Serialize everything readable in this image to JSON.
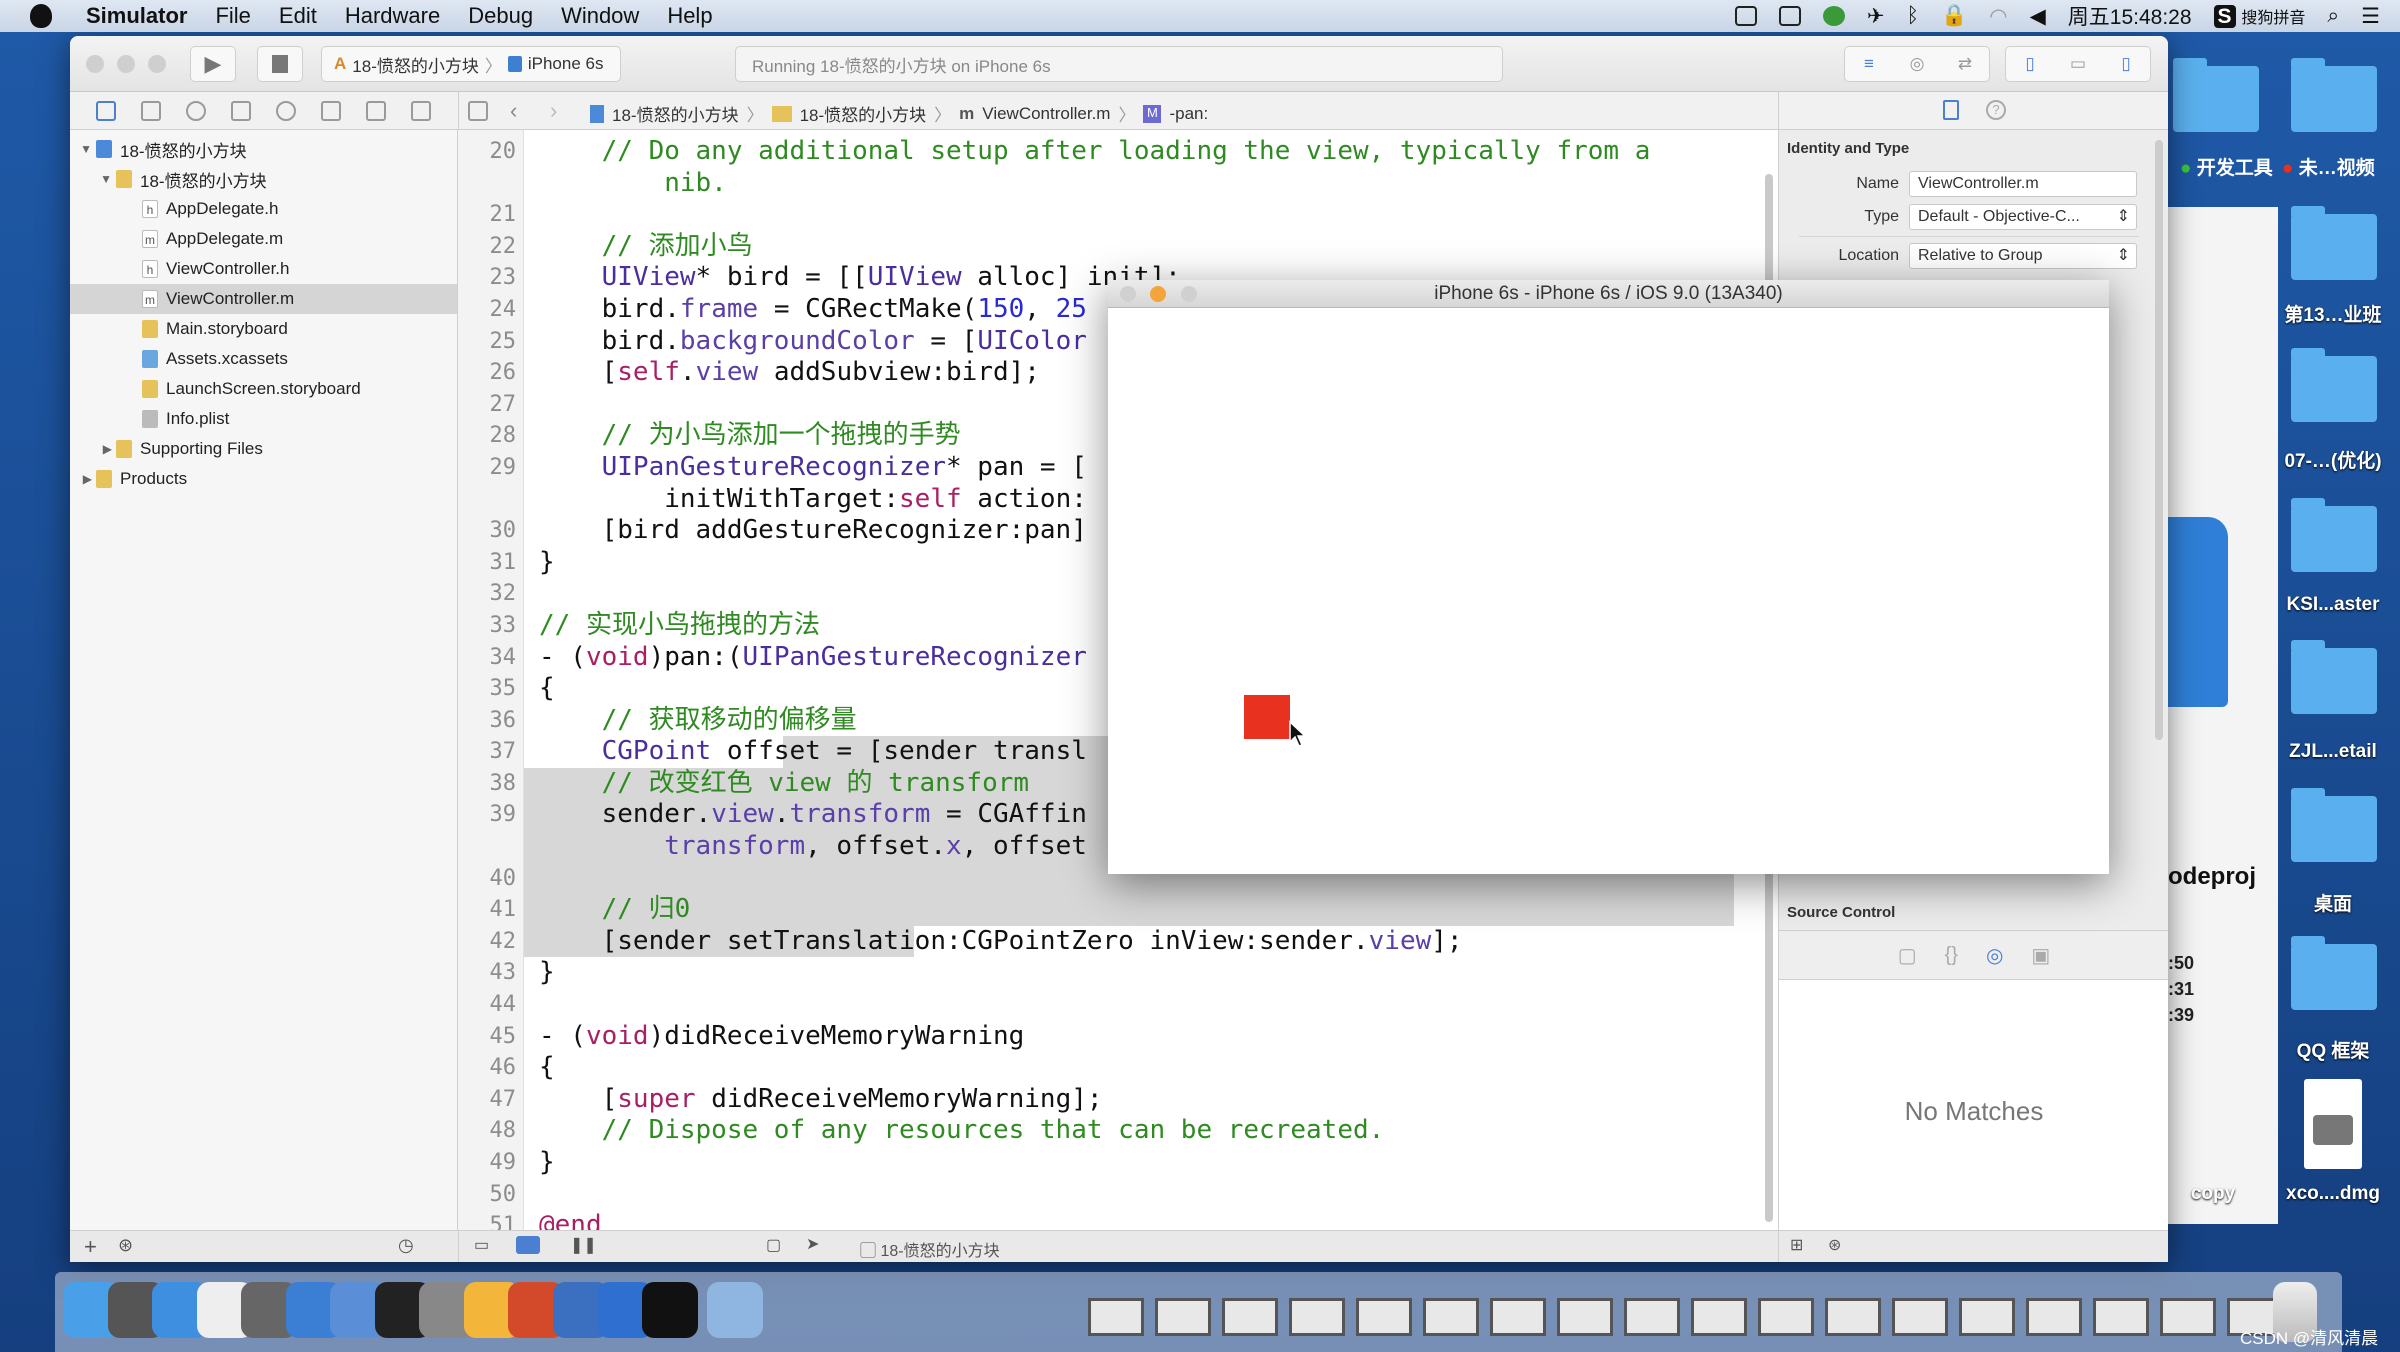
{
  "menubar": {
    "app": "Simulator",
    "items": [
      "File",
      "Edit",
      "Hardware",
      "Debug",
      "Window",
      "Help"
    ],
    "clock": "周五15:48:28",
    "ime": "搜狗拼音"
  },
  "toolbar": {
    "scheme": "18-愤怒的小方块",
    "device": "iPhone 6s",
    "activity": "Running 18-愤怒的小方块 on iPhone 6s"
  },
  "jumpbar": [
    "18-愤怒的小方块",
    "18-愤怒的小方块",
    "ViewController.m",
    "-pan:"
  ],
  "sidebar": {
    "items": [
      {
        "label": "18-愤怒的小方块",
        "level": 0,
        "icon": "project",
        "open": true
      },
      {
        "label": "18-愤怒的小方块",
        "level": 1,
        "icon": "folder",
        "open": true
      },
      {
        "label": "AppDelegate.h",
        "level": 2,
        "icon": "h"
      },
      {
        "label": "AppDelegate.m",
        "level": 2,
        "icon": "m"
      },
      {
        "label": "ViewController.h",
        "level": 2,
        "icon": "h"
      },
      {
        "label": "ViewController.m",
        "level": 2,
        "icon": "m",
        "selected": true
      },
      {
        "label": "Main.storyboard",
        "level": 2,
        "icon": "storyboard"
      },
      {
        "label": "Assets.xcassets",
        "level": 2,
        "icon": "assets"
      },
      {
        "label": "LaunchScreen.storyboard",
        "level": 2,
        "icon": "storyboard"
      },
      {
        "label": "Info.plist",
        "level": 2,
        "icon": "plist"
      },
      {
        "label": "Supporting Files",
        "level": 1,
        "icon": "folder",
        "open": false
      },
      {
        "label": "Products",
        "level": 0,
        "icon": "folder",
        "open": false
      }
    ]
  },
  "code": [
    {
      "n": "20",
      "tk": [
        [
          "c",
          "    // Do any additional setup after loading the view, typically from a"
        ]
      ]
    },
    {
      "n": "",
      "tk": [
        [
          "c",
          "        nib."
        ]
      ]
    },
    {
      "n": "21",
      "tk": []
    },
    {
      "n": "22",
      "tk": [
        [
          "c",
          "    // 添加小鸟"
        ]
      ]
    },
    {
      "n": "23",
      "tk": [
        [
          "",
          "    "
        ],
        [
          "t",
          "UIView"
        ],
        [
          "",
          "* bird = [["
        ],
        [
          "t",
          "UIView"
        ],
        [
          "",
          " alloc] init];"
        ]
      ]
    },
    {
      "n": "24",
      "tk": [
        [
          "",
          "    bird."
        ],
        [
          "p",
          "frame"
        ],
        [
          "",
          " = CGRectMake("
        ],
        [
          "n",
          "150"
        ],
        [
          "",
          ", "
        ],
        [
          "n",
          "25"
        ]
      ]
    },
    {
      "n": "25",
      "tk": [
        [
          "",
          "    bird."
        ],
        [
          "p",
          "backgroundColor"
        ],
        [
          "",
          " = ["
        ],
        [
          "t",
          "UIColor"
        ]
      ]
    },
    {
      "n": "26",
      "tk": [
        [
          "",
          "    ["
        ],
        [
          "k",
          "self"
        ],
        [
          "",
          "."
        ],
        [
          "p",
          "view"
        ],
        [
          "",
          " addSubview:bird];"
        ]
      ]
    },
    {
      "n": "27",
      "tk": []
    },
    {
      "n": "28",
      "tk": [
        [
          "c",
          "    // 为小鸟添加一个拖拽的手势"
        ]
      ]
    },
    {
      "n": "29",
      "tk": [
        [
          "",
          "    "
        ],
        [
          "t",
          "UIPanGestureRecognizer"
        ],
        [
          "",
          "* pan = ["
        ]
      ]
    },
    {
      "n": "",
      "tk": [
        [
          "",
          "        initWithTarget:"
        ],
        [
          "k",
          "self"
        ],
        [
          "",
          " action:"
        ]
      ]
    },
    {
      "n": "30",
      "tk": [
        [
          "",
          "    [bird addGestureRecognizer:pan]"
        ]
      ]
    },
    {
      "n": "31",
      "tk": [
        [
          "",
          "}"
        ]
      ]
    },
    {
      "n": "32",
      "tk": []
    },
    {
      "n": "33",
      "tk": [
        [
          "c",
          "// 实现小鸟拖拽的方法"
        ]
      ]
    },
    {
      "n": "34",
      "tk": [
        [
          "",
          "- ("
        ],
        [
          "k",
          "void"
        ],
        [
          "",
          ")pan:("
        ],
        [
          "t",
          "UIPanGestureRecognizer"
        ]
      ]
    },
    {
      "n": "35",
      "tk": [
        [
          "",
          "{"
        ]
      ]
    },
    {
      "n": "36",
      "tk": [
        [
          "c",
          "    // 获取移动的偏移量"
        ]
      ]
    },
    {
      "n": "37",
      "tk": [
        [
          "",
          "    "
        ],
        [
          "t",
          "CGPoint"
        ],
        [
          "",
          " offset = [sender transl"
        ]
      ],
      "hl": "partial-start"
    },
    {
      "n": "38",
      "tk": [
        [
          "c",
          "    // 改变红色 view 的 transform"
        ]
      ],
      "hl": "full"
    },
    {
      "n": "39",
      "tk": [
        [
          "",
          "    sender."
        ],
        [
          "p",
          "view"
        ],
        [
          "",
          "."
        ],
        [
          "p",
          "transform"
        ],
        [
          "",
          " = CGAffin"
        ]
      ],
      "hl": "full"
    },
    {
      "n": "",
      "tk": [
        [
          "",
          "        "
        ],
        [
          "p",
          "transform"
        ],
        [
          "",
          ", offset."
        ],
        [
          "p",
          "x"
        ],
        [
          "",
          ", offset"
        ]
      ],
      "hl": "full"
    },
    {
      "n": "40",
      "tk": [],
      "hl": "full"
    },
    {
      "n": "41",
      "tk": [
        [
          "c",
          "    // 归0"
        ]
      ],
      "hl": "full"
    },
    {
      "n": "42",
      "tk": [
        [
          "",
          "    [sender setTranslation:CGPointZero inView:sender."
        ],
        [
          "p",
          "view"
        ],
        [
          "",
          "];"
        ]
      ],
      "hl": "partial-end"
    },
    {
      "n": "43",
      "tk": [
        [
          "",
          "}"
        ]
      ]
    },
    {
      "n": "44",
      "tk": []
    },
    {
      "n": "45",
      "tk": [
        [
          "",
          "- ("
        ],
        [
          "k",
          "void"
        ],
        [
          "",
          ")didReceiveMemoryWarning"
        ]
      ]
    },
    {
      "n": "46",
      "tk": [
        [
          "",
          "{"
        ]
      ]
    },
    {
      "n": "47",
      "tk": [
        [
          "",
          "    ["
        ],
        [
          "k",
          "super"
        ],
        [
          "",
          " didReceiveMemoryWarning];"
        ]
      ]
    },
    {
      "n": "48",
      "tk": [
        [
          "c",
          "    // Dispose of any resources that can be recreated."
        ]
      ]
    },
    {
      "n": "49",
      "tk": [
        [
          "",
          "}"
        ]
      ]
    },
    {
      "n": "50",
      "tk": []
    },
    {
      "n": "51",
      "tk": [
        [
          "k",
          "@end"
        ]
      ]
    }
  ],
  "inspector": {
    "section": "Identity and Type",
    "name_label": "Name",
    "name": "ViewController.m",
    "type_label": "Type",
    "type": "Default - Objective-C...",
    "location_label": "Location",
    "location": "Relative to Group",
    "source_control": "Source Control",
    "no_matches": "No Matches"
  },
  "bottombar": {
    "target": "18-愤怒的小方块"
  },
  "simulator": {
    "title": "iPhone 6s - iPhone 6s / iOS 9.0 (13A340)",
    "square_color": "#e8321f"
  },
  "finder": {
    "filename": "odeproj",
    "times": [
      ":50",
      ":31",
      ":39"
    ]
  },
  "desktop": {
    "tags": [
      {
        "label": "开发工具",
        "color": "#3cc43c"
      },
      {
        "label": "未…视频",
        "color": "#e8321f"
      }
    ],
    "items": [
      "第13…业班",
      "07-…(优化)",
      "KSI...aster",
      "ZJL...etail",
      "桌面",
      "QQ 框架",
      "xco....dmg"
    ],
    "copy": "copy"
  },
  "watermark": "CSDN @清风清晨"
}
